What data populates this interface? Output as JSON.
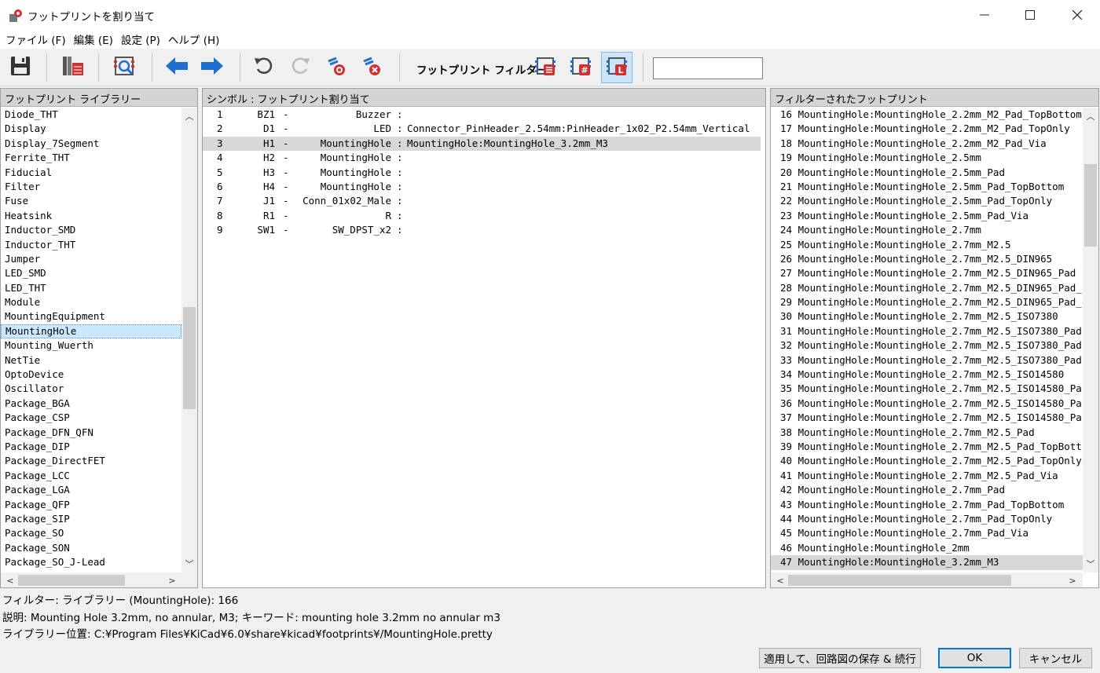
{
  "window": {
    "title": "フットプリントを割り当て"
  },
  "menu": [
    "ファイル (F)",
    "編集 (E)",
    "設定 (P)",
    "ヘルプ (H)"
  ],
  "toolbar": {
    "filter_label": "フットプリント フィルター:",
    "search_value": ""
  },
  "libraries": {
    "header": "フットプリント ライブラリー",
    "selected": "MountingHole",
    "items": [
      "Diode_THT",
      "Display",
      "Display_7Segment",
      "Ferrite_THT",
      "Fiducial",
      "Filter",
      "Fuse",
      "Heatsink",
      "Inductor_SMD",
      "Inductor_THT",
      "Jumper",
      "LED_SMD",
      "LED_THT",
      "Module",
      "MountingEquipment",
      "MountingHole",
      "Mounting_Wuerth",
      "NetTie",
      "OptoDevice",
      "Oscillator",
      "Package_BGA",
      "Package_CSP",
      "Package_DFN_QFN",
      "Package_DIP",
      "Package_DirectFET",
      "Package_LCC",
      "Package_LGA",
      "Package_QFP",
      "Package_SIP",
      "Package_SO",
      "Package_SON",
      "Package_SO_J-Lead"
    ]
  },
  "symbols": {
    "header": "シンボル : フットプリント割り当て",
    "selected_index": 2,
    "rows": [
      {
        "num": "1",
        "ref": "BZ1",
        "value": "Buzzer",
        "footprint": ""
      },
      {
        "num": "2",
        "ref": "D1",
        "value": "LED",
        "footprint": "Connector_PinHeader_2.54mm:PinHeader_1x02_P2.54mm_Vertical"
      },
      {
        "num": "3",
        "ref": "H1",
        "value": "MountingHole",
        "footprint": "MountingHole:MountingHole_3.2mm_M3"
      },
      {
        "num": "4",
        "ref": "H2",
        "value": "MountingHole",
        "footprint": ""
      },
      {
        "num": "5",
        "ref": "H3",
        "value": "MountingHole",
        "footprint": ""
      },
      {
        "num": "6",
        "ref": "H4",
        "value": "MountingHole",
        "footprint": ""
      },
      {
        "num": "7",
        "ref": "J1",
        "value": "Conn_01x02_Male",
        "footprint": ""
      },
      {
        "num": "8",
        "ref": "R1",
        "value": "R",
        "footprint": ""
      },
      {
        "num": "9",
        "ref": "SW1",
        "value": "SW_DPST_x2",
        "footprint": ""
      }
    ]
  },
  "footprints": {
    "header": "フィルターされたフットプリント",
    "selected_index": 31,
    "items": [
      "16 MountingHole:MountingHole_2.2mm_M2_Pad_TopBottom",
      "17 MountingHole:MountingHole_2.2mm_M2_Pad_TopOnly",
      "18 MountingHole:MountingHole_2.2mm_M2_Pad_Via",
      "19 MountingHole:MountingHole_2.5mm",
      "20 MountingHole:MountingHole_2.5mm_Pad",
      "21 MountingHole:MountingHole_2.5mm_Pad_TopBottom",
      "22 MountingHole:MountingHole_2.5mm_Pad_TopOnly",
      "23 MountingHole:MountingHole_2.5mm_Pad_Via",
      "24 MountingHole:MountingHole_2.7mm",
      "25 MountingHole:MountingHole_2.7mm_M2.5",
      "26 MountingHole:MountingHole_2.7mm_M2.5_DIN965",
      "27 MountingHole:MountingHole_2.7mm_M2.5_DIN965_Pad",
      "28 MountingHole:MountingHole_2.7mm_M2.5_DIN965_Pad_",
      "29 MountingHole:MountingHole_2.7mm_M2.5_DIN965_Pad_",
      "30 MountingHole:MountingHole_2.7mm_M2.5_ISO7380",
      "31 MountingHole:MountingHole_2.7mm_M2.5_ISO7380_Pad",
      "32 MountingHole:MountingHole_2.7mm_M2.5_ISO7380_Pad",
      "33 MountingHole:MountingHole_2.7mm_M2.5_ISO7380_Pad",
      "34 MountingHole:MountingHole_2.7mm_M2.5_ISO14580",
      "35 MountingHole:MountingHole_2.7mm_M2.5_ISO14580_Pa",
      "36 MountingHole:MountingHole_2.7mm_M2.5_ISO14580_Pa",
      "37 MountingHole:MountingHole_2.7mm_M2.5_ISO14580_Pa",
      "38 MountingHole:MountingHole_2.7mm_M2.5_Pad",
      "39 MountingHole:MountingHole_2.7mm_M2.5_Pad_TopBott",
      "40 MountingHole:MountingHole_2.7mm_M2.5_Pad_TopOnly",
      "41 MountingHole:MountingHole_2.7mm_M2.5_Pad_Via",
      "42 MountingHole:MountingHole_2.7mm_Pad",
      "43 MountingHole:MountingHole_2.7mm_Pad_TopBottom",
      "44 MountingHole:MountingHole_2.7mm_Pad_TopOnly",
      "45 MountingHole:MountingHole_2.7mm_Pad_Via",
      "46 MountingHole:MountingHole_2mm",
      "47 MountingHole:MountingHole_3.2mm_M3"
    ]
  },
  "status": {
    "filter": "フィルター: ライブラリー (MountingHole): 166",
    "description": "説明: Mounting Hole 3.2mm, no annular, M3;  キーワード: mounting hole 3.2mm no annular m3",
    "location": "ライブラリー位置: C:¥Program Files¥KiCad¥6.0¥share¥kicad¥footprints¥/MountingHole.pretty"
  },
  "buttons": {
    "apply": "適用して、回路図の保存 & 続行",
    "ok": "OK",
    "cancel": "キャンセル"
  },
  "colors": {
    "accent_blue": "#1f6fd0",
    "selection_gray": "#d8d8d8",
    "selection_blue": "#cce8ff",
    "header_gray": "#d4d4d4"
  }
}
